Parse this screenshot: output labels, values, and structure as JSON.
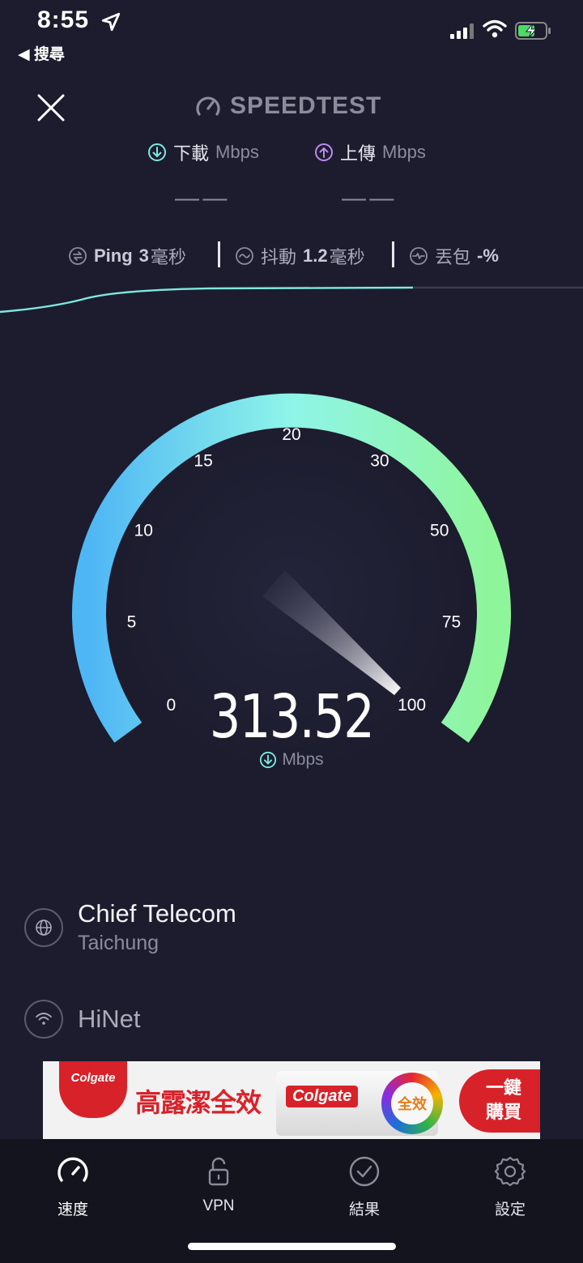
{
  "status_bar": {
    "time": "8:55",
    "back_app": "◀ 搜尋"
  },
  "header": {
    "app_title": "SPEEDTEST"
  },
  "download": {
    "label": "下載",
    "unit": "Mbps",
    "value": "— —"
  },
  "upload": {
    "label": "上傳",
    "unit": "Mbps",
    "value": "— —"
  },
  "stats": {
    "ping_label": "Ping",
    "ping_value": "3",
    "ping_unit": "毫秒",
    "jitter_label": "抖動",
    "jitter_value": "1.2",
    "jitter_unit": "毫秒",
    "loss_label": "丟包",
    "loss_value": "-%"
  },
  "gauge": {
    "ticks": [
      "0",
      "5",
      "10",
      "15",
      "20",
      "30",
      "50",
      "75",
      "100"
    ],
    "current_speed": "313.52",
    "unit": "Mbps",
    "gradient_start": "#4fb6f5",
    "gradient_mid": "#8ff5e8",
    "gradient_end": "#8ff59a"
  },
  "server": {
    "name": "Chief Telecom",
    "location": "Taichung"
  },
  "isp": {
    "name": "HiNet"
  },
  "ad": {
    "brand": "Colgate",
    "headline": "高露潔全效",
    "badge": "全效",
    "cta_line1": "一鍵",
    "cta_line2": "購買"
  },
  "tabs": [
    {
      "label": "速度",
      "icon": "speedometer-icon"
    },
    {
      "label": "VPN",
      "icon": "lock-icon"
    },
    {
      "label": "結果",
      "icon": "checkmark-circle-icon"
    },
    {
      "label": "設定",
      "icon": "gear-icon"
    }
  ]
}
